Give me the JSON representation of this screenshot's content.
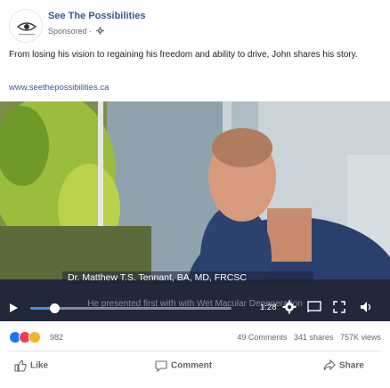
{
  "post": {
    "page_name": "See The Possibilities",
    "sponsored": "Sponsored ·",
    "body": "From losing his vision to regaining his freedom and ability to drive, John shares his story.",
    "link": "www.seethepossibilities.ca"
  },
  "video": {
    "lower_third": "Dr. Matthew T.S. Tennant, BA, MD, FRCSC",
    "caption": "He presented first with with Wet Macular Degeneration",
    "time": "1:28",
    "progress": 0.12
  },
  "stats": {
    "reaction_count": "982",
    "comments": "49 Comments",
    "shares": "341 shares",
    "views": "757K views"
  },
  "actions": {
    "like": "Like",
    "comment": "Comment",
    "share": "Share"
  },
  "icons": [
    "settings-icon",
    "globe-icon",
    "play-icon",
    "gear-icon",
    "cast-icon",
    "fullscreen-icon",
    "volume-icon",
    "like-icon",
    "comment-icon",
    "share-icon"
  ],
  "colors": {
    "link": "#385898",
    "progress": "#4a90e2",
    "like_reaction": "#1877f2",
    "love_reaction": "#f33e58",
    "wow_reaction": "#f7b125"
  }
}
